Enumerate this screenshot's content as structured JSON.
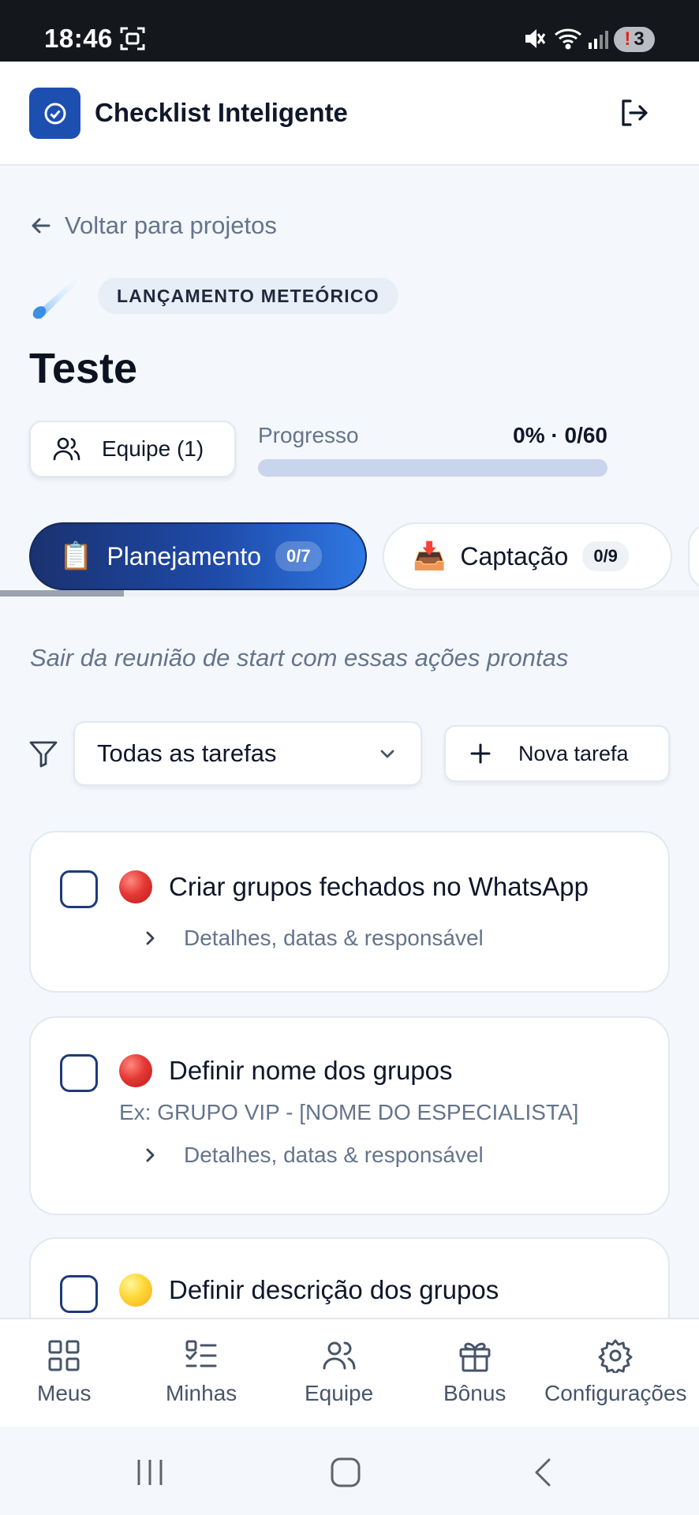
{
  "status_bar": {
    "time": "18:46",
    "battery": "3"
  },
  "header": {
    "app_title": "Checklist Inteligente"
  },
  "nav_back": "Voltar para projetos",
  "project": {
    "category": "LANÇAMENTO METEÓRICO",
    "name": "Teste",
    "team_button": "Equipe (1)",
    "progress_label": "Progresso",
    "progress_text": "0% · 0/60",
    "progress_fraction": 0
  },
  "stages": [
    {
      "emoji": "📋",
      "label": "Planejamento",
      "count": "0/7",
      "active": true
    },
    {
      "emoji": "📥",
      "label": "Captação",
      "count": "0/9",
      "active": false
    }
  ],
  "stage_description": "Sair da reunião de start com essas ações prontas",
  "filter": {
    "selected": "Todas as tarefas"
  },
  "new_task_label": "Nova tarefa",
  "tasks": [
    {
      "priority": "red",
      "title": "Criar grupos fechados no WhatsApp",
      "subtitle": "",
      "details": "Detalhes, datas & responsável"
    },
    {
      "priority": "red",
      "title": "Definir nome dos grupos",
      "subtitle": "Ex: GRUPO VIP - [NOME DO ESPECIALISTA]",
      "details": "Detalhes, datas & responsável"
    },
    {
      "priority": "yellow",
      "title": "Definir descrição dos grupos",
      "subtitle": "",
      "details": ""
    }
  ],
  "bottom_nav": [
    {
      "label": "Meus",
      "icon": "grid-icon"
    },
    {
      "label": "Minhas",
      "icon": "list-check-icon"
    },
    {
      "label": "Equipe",
      "icon": "users-icon"
    },
    {
      "label": "Bônus",
      "icon": "gift-icon"
    },
    {
      "label": "Configurações",
      "icon": "gear-icon"
    }
  ],
  "colors": {
    "brand": "#1d4fb0",
    "active_tab_start": "#1a3270",
    "active_tab_end": "#2f78e3",
    "progress_track": "#c9d5ec"
  }
}
